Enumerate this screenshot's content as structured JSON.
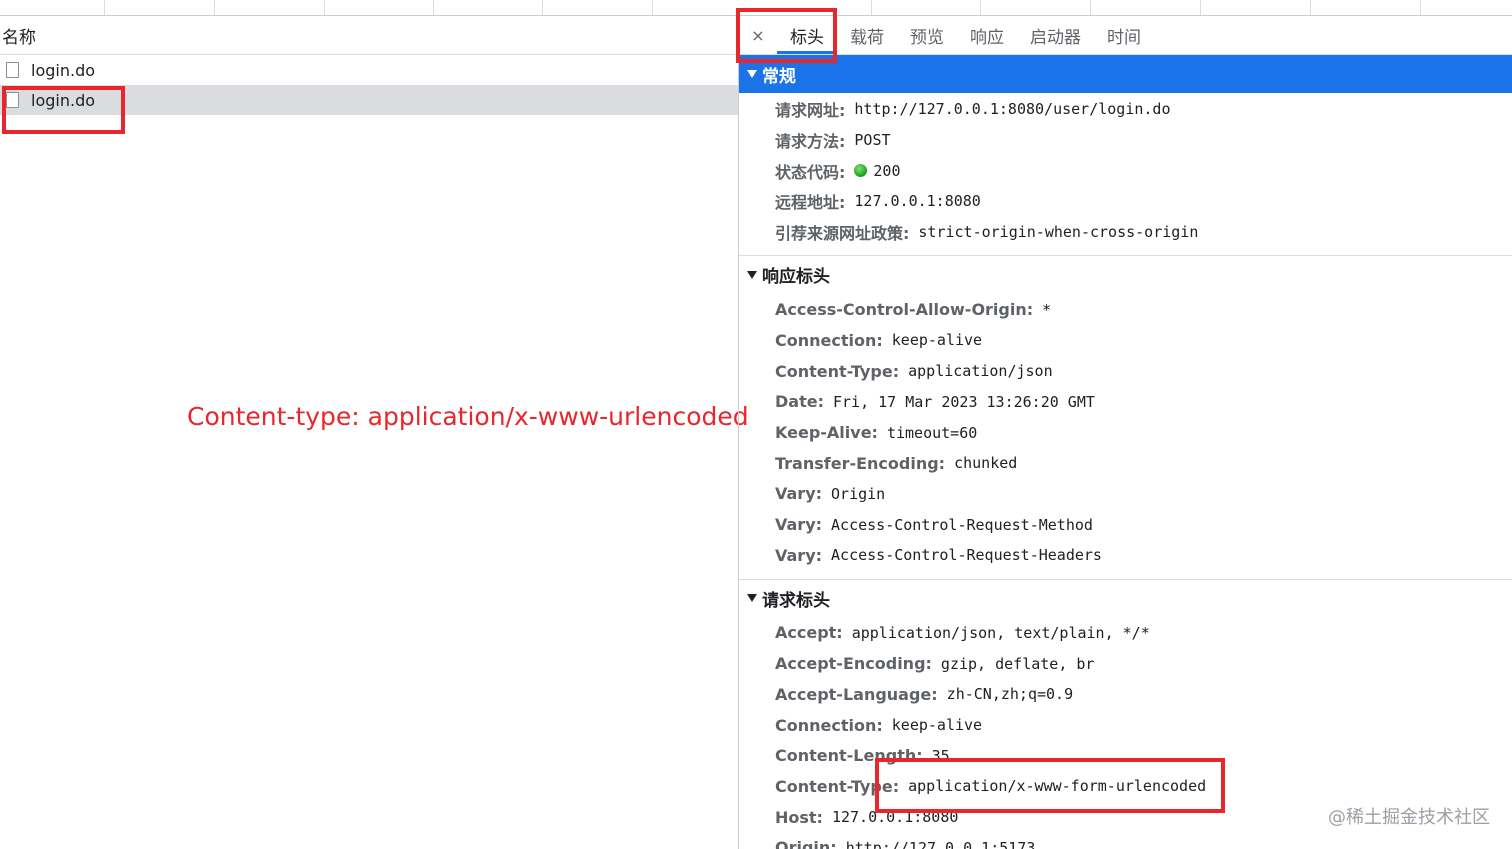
{
  "list": {
    "header": "名称",
    "requests": [
      {
        "name": "login.do",
        "selected": false
      },
      {
        "name": "login.do",
        "selected": true
      }
    ]
  },
  "annotation": "Content-type: application/x-www-urlencoded",
  "tabs": {
    "close": "×",
    "items": [
      "标头",
      "载荷",
      "预览",
      "响应",
      "启动器",
      "时间"
    ],
    "active": "标头"
  },
  "general": {
    "title": "常规",
    "rows": [
      {
        "name": "请求网址:",
        "value": "http://127.0.0.1:8080/user/login.do"
      },
      {
        "name": "请求方法:",
        "value": "POST"
      },
      {
        "name": "状态代码:",
        "value": "200",
        "status_color": "#1a9e1a"
      },
      {
        "name": "远程地址:",
        "value": "127.0.0.1:8080"
      },
      {
        "name": "引荐来源网址政策:",
        "value": "strict-origin-when-cross-origin"
      }
    ]
  },
  "response_headers": {
    "title": "响应标头",
    "rows": [
      {
        "name": "Access-Control-Allow-Origin:",
        "value": "*"
      },
      {
        "name": "Connection:",
        "value": "keep-alive"
      },
      {
        "name": "Content-Type:",
        "value": "application/json"
      },
      {
        "name": "Date:",
        "value": "Fri, 17 Mar 2023 13:26:20 GMT"
      },
      {
        "name": "Keep-Alive:",
        "value": "timeout=60"
      },
      {
        "name": "Transfer-Encoding:",
        "value": "chunked"
      },
      {
        "name": "Vary:",
        "value": "Origin"
      },
      {
        "name": "Vary:",
        "value": "Access-Control-Request-Method"
      },
      {
        "name": "Vary:",
        "value": "Access-Control-Request-Headers"
      }
    ]
  },
  "request_headers": {
    "title": "请求标头",
    "rows": [
      {
        "name": "Accept:",
        "value": "application/json, text/plain, */*"
      },
      {
        "name": "Accept-Encoding:",
        "value": "gzip, deflate, br"
      },
      {
        "name": "Accept-Language:",
        "value": "zh-CN,zh;q=0.9"
      },
      {
        "name": "Connection:",
        "value": "keep-alive"
      },
      {
        "name": "Content-Length:",
        "value": "35"
      },
      {
        "name": "Content-Type:",
        "value": "application/x-www-form-urlencoded"
      },
      {
        "name": "Host:",
        "value": "127.0.0.1:8080"
      },
      {
        "name": "Origin:",
        "value": "http://127.0.0.1:5173"
      }
    ]
  },
  "watermark": "@稀土掘金技术社区",
  "colors": {
    "accent": "#1a73e8",
    "highlight": "#e8262b"
  }
}
